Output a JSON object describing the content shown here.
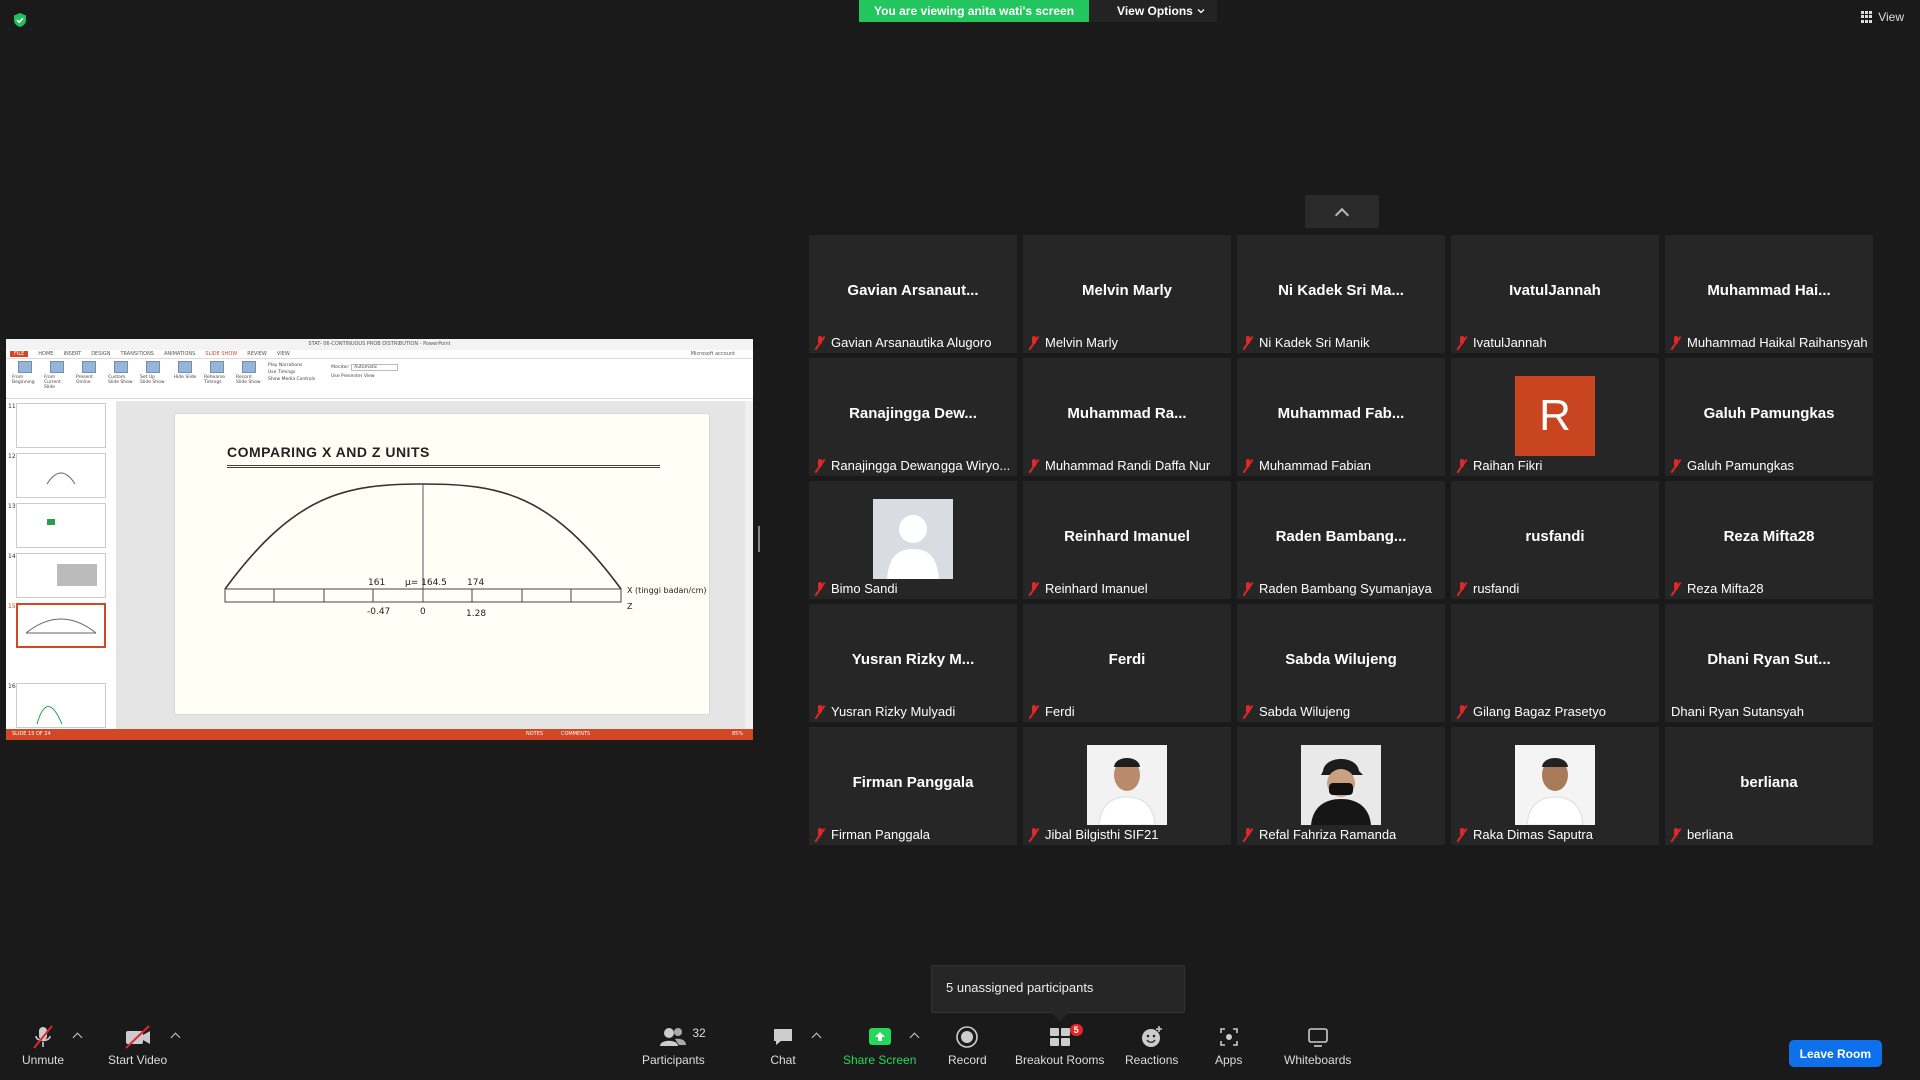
{
  "banner": {
    "viewing_text": "You are viewing anita wati's screen",
    "view_options": "View Options"
  },
  "view_button": "View",
  "shared_screen": {
    "window_title": "STAT- 06-CONTINUOUS PROB DISTRIBUTION - PowerPoint",
    "account": "Microsoft account",
    "tabs": [
      "FILE",
      "HOME",
      "INSERT",
      "DESIGN",
      "TRANSITIONS",
      "ANIMATIONS",
      "SLIDE SHOW",
      "REVIEW",
      "VIEW"
    ],
    "active_tab": "SLIDE SHOW",
    "ribbon": [
      "From Beginning",
      "From Current Slide",
      "Present Online",
      "Custom Slide Show",
      "Set Up Slide Show",
      "Hide Slide",
      "Rehearse Timings",
      "Record Slide Show"
    ],
    "ribbon_checks": [
      "Play Narrations",
      "Use Timings",
      "Show Media Controls"
    ],
    "monitor_label": "Monitor:",
    "monitor_value": "Automatic",
    "presenter_view": "Use Presenter View",
    "thumb_numbers": [
      "11",
      "12",
      "13",
      "14",
      "15",
      "16"
    ],
    "slide": {
      "title": "COMPARING  X  AND  Z  UNITS",
      "x_label": "X (tinggi badan/cm)",
      "z_label": "Z",
      "x_ticks": [
        "161",
        "μ= 164.5",
        "174"
      ],
      "z_ticks": [
        "-0.47",
        "0",
        "1.28"
      ]
    },
    "status_left": "SLIDE 15 OF 24",
    "status_notes": "NOTES",
    "status_comments": "COMMENTS",
    "zoom": "85%"
  },
  "participants_tiles": [
    {
      "big": "Gavian  Arsanaut...",
      "label": "Gavian Arsanautika Alugoro",
      "muted": true
    },
    {
      "big": "Melvin Marly",
      "label": "Melvin Marly",
      "muted": true
    },
    {
      "big": "Ni  Kadek  Sri  Ma...",
      "label": "Ni Kadek Sri Manik",
      "muted": true
    },
    {
      "big": "IvatulJannah",
      "label": "IvatulJannah",
      "muted": true
    },
    {
      "big": "Muhammad  Hai...",
      "label": "Muhammad Haikal Raihansyah",
      "muted": true
    },
    {
      "big": "Ranajingga  Dew...",
      "label": "Ranajingga Dewangga Wiryo...",
      "muted": true
    },
    {
      "big": "Muhammad  Ra...",
      "label": "Muhammad Randi Daffa Nur",
      "muted": true
    },
    {
      "big": "Muhammad  Fab...",
      "label": "Muhammad Fabian",
      "muted": true
    },
    {
      "big": "",
      "avatar_letter": "R",
      "label": "Raihan Fikri",
      "muted": true
    },
    {
      "big": "Galuh Pamungkas",
      "label": "Galuh Pamungkas",
      "muted": true
    },
    {
      "big": "",
      "avatar": "silhouette",
      "label": "Bimo Sandi",
      "muted": true
    },
    {
      "big": "Reinhard Imanuel",
      "label": "Reinhard Imanuel",
      "muted": true
    },
    {
      "big": "Raden  Bambang...",
      "label": "Raden Bambang Syumanjaya",
      "muted": true
    },
    {
      "big": "rusfandi",
      "label": "rusfandi",
      "muted": true
    },
    {
      "big": "Reza Mifta28",
      "label": "Reza Mifta28",
      "muted": true
    },
    {
      "big": "Yusran  Rizky  M...",
      "label": "Yusran Rizky Mulyadi",
      "muted": true
    },
    {
      "big": "Ferdi",
      "label": "Ferdi",
      "muted": true
    },
    {
      "big": "Sabda Wilujeng",
      "label": "Sabda Wilujeng",
      "muted": true
    },
    {
      "big": "",
      "label": "Gilang Bagaz Prasetyo",
      "muted": true
    },
    {
      "big": "Dhani  Ryan  Sut...",
      "label": "Dhani Ryan Sutansyah",
      "muted": false
    },
    {
      "big": "Firman Panggala",
      "label": "Firman Panggala",
      "muted": true
    },
    {
      "big": "",
      "avatar": "photo-shirt",
      "label": "Jibal Bilgisthi SIF21",
      "muted": true
    },
    {
      "big": "",
      "avatar": "photo-cap",
      "label": "Refal Fahriza Ramanda",
      "muted": true
    },
    {
      "big": "",
      "avatar": "photo-shirt",
      "label": "Raka Dimas Saputra",
      "muted": true
    },
    {
      "big": "berliana",
      "label": "berliana",
      "muted": true
    }
  ],
  "unassigned_popup": "5 unassigned participants",
  "toolbar": {
    "unmute": "Unmute",
    "start_video": "Start Video",
    "participants": "Participants",
    "participants_count": "32",
    "chat": "Chat",
    "share_screen": "Share Screen",
    "record": "Record",
    "breakout_rooms": "Breakout Rooms",
    "breakout_badge": "5",
    "reactions": "Reactions",
    "apps": "Apps",
    "whiteboards": "Whiteboards",
    "leave": "Leave Room"
  },
  "colors": {
    "banner_green": "#22c55e",
    "muted_red": "#e02828",
    "leave_blue": "#0e71eb",
    "ppt_accent": "#d24726",
    "share_green": "#23d959"
  }
}
